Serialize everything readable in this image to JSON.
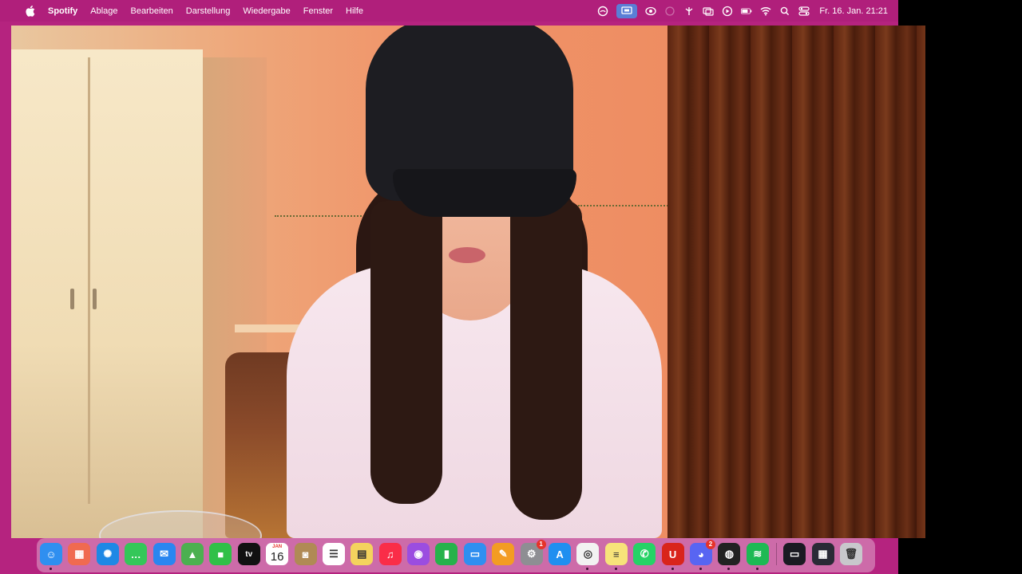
{
  "menubar": {
    "app_name": "Spotify",
    "menus": [
      "Ablage",
      "Bearbeiten",
      "Darstellung",
      "Wiedergabe",
      "Fenster",
      "Hilfe"
    ],
    "status_icons": [
      "creative-cloud-icon",
      "screen-share-icon",
      "airplay-icon",
      "focus-icon",
      "control-icon",
      "display-icon",
      "play-icon",
      "battery-icon",
      "wifi-icon",
      "spotlight-search-icon",
      "control-center-icon"
    ],
    "clock": "Fr. 16. Jan.  21:21"
  },
  "video": {
    "description": "webcam-feed"
  },
  "dock": {
    "apps": [
      {
        "name": "finder",
        "color": "#2f8ff0",
        "glyph": "☺",
        "running": true
      },
      {
        "name": "launchpad",
        "color": "#f06a50",
        "glyph": "▦",
        "running": false
      },
      {
        "name": "safari",
        "color": "#1e88e5",
        "glyph": "✺",
        "running": false
      },
      {
        "name": "messages",
        "color": "#34c759",
        "glyph": "…",
        "running": false
      },
      {
        "name": "mail",
        "color": "#2a86f0",
        "glyph": "✉",
        "running": false
      },
      {
        "name": "maps",
        "color": "#4cb050",
        "glyph": "▲",
        "running": false
      },
      {
        "name": "facetime",
        "color": "#30c048",
        "glyph": "■",
        "running": false
      },
      {
        "name": "apple-tv",
        "color": "#111111",
        "glyph": "tv",
        "running": false
      },
      {
        "name": "calendar",
        "color": "#ffffff",
        "glyph": "",
        "running": false
      },
      {
        "name": "contacts",
        "color": "#b08a55",
        "glyph": "◙",
        "running": false
      },
      {
        "name": "reminders",
        "color": "#ffffff",
        "glyph": "☰",
        "running": false
      },
      {
        "name": "notes",
        "color": "#f4d35e",
        "glyph": "▤",
        "running": false
      },
      {
        "name": "music",
        "color": "#fa2d48",
        "glyph": "♫",
        "running": false
      },
      {
        "name": "podcasts",
        "color": "#9b4de0",
        "glyph": "◉",
        "running": false
      },
      {
        "name": "numbers",
        "color": "#26b24b",
        "glyph": "▮",
        "running": false
      },
      {
        "name": "keynote",
        "color": "#2f8ff0",
        "glyph": "▭",
        "running": false
      },
      {
        "name": "pages",
        "color": "#f39c23",
        "glyph": "✎",
        "running": false
      },
      {
        "name": "system-settings",
        "color": "#8e8e93",
        "glyph": "⚙",
        "running": false,
        "badge": "1"
      },
      {
        "name": "app-store",
        "color": "#1f8ff0",
        "glyph": "A",
        "running": false
      },
      {
        "name": "chrome",
        "color": "#f2f2f2",
        "glyph": "◎",
        "running": true
      },
      {
        "name": "stickies",
        "color": "#f7e37a",
        "glyph": "≡",
        "running": true
      },
      {
        "name": "whatsapp",
        "color": "#25d366",
        "glyph": "✆",
        "running": false
      },
      {
        "name": "uhh",
        "color": "#d9241b",
        "glyph": "U",
        "running": true
      },
      {
        "name": "discord",
        "color": "#5865f2",
        "glyph": "◕",
        "running": true,
        "badge": "2"
      },
      {
        "name": "obs",
        "color": "#222222",
        "glyph": "◍",
        "running": true
      },
      {
        "name": "spotify",
        "color": "#1db954",
        "glyph": "≋",
        "running": true
      }
    ],
    "calendar": {
      "month": "JAN",
      "day": "16"
    },
    "recent": [
      {
        "name": "recent-window-1",
        "color": "#1a1a22",
        "glyph": "▭",
        "running": false
      },
      {
        "name": "recent-window-2",
        "color": "#2a2a36",
        "glyph": "▦",
        "running": false
      },
      {
        "name": "trash",
        "color": "#c8c8cc",
        "glyph": "🗑",
        "running": false
      }
    ]
  }
}
